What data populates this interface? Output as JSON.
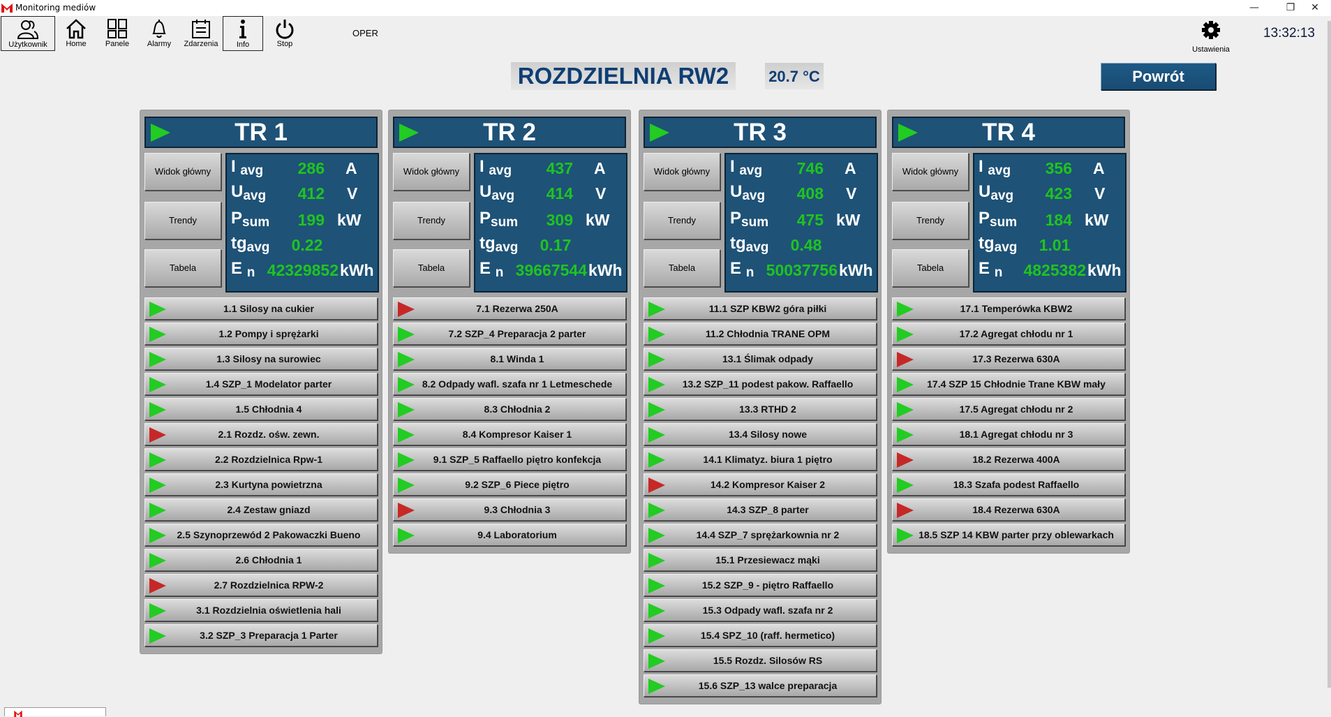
{
  "window": {
    "title": "Monitoring mediów",
    "controls": [
      "minimize",
      "restore",
      "close"
    ]
  },
  "toolbar": {
    "buttons": [
      {
        "label": "Użytkownik",
        "icon": "users-icon"
      },
      {
        "label": "Home",
        "icon": "home-icon"
      },
      {
        "label": "Panele",
        "icon": "panels-icon"
      },
      {
        "label": "Alarmy",
        "icon": "bell-icon"
      },
      {
        "label": "Zdarzenia",
        "icon": "calendar-icon"
      },
      {
        "label": "Info",
        "icon": "info-icon"
      },
      {
        "label": "Stop",
        "icon": "power-icon"
      }
    ],
    "mode": "OPER",
    "settings_label": "Ustawienia",
    "clock": "13:32:13"
  },
  "header": {
    "title": "ROZDZIELNIA RW2",
    "temperature": "20.7 °C",
    "back_label": "Powrót"
  },
  "colors": {
    "panel_blue": "#1e5277",
    "value_green": "#1fc41f",
    "status_ok": "#22cc22",
    "status_alarm": "#c62828",
    "title_blue": "#0e3e73"
  },
  "side_buttons": [
    "Widok główny",
    "Trendy",
    "Tabela"
  ],
  "measure_labels": {
    "i": {
      "main": "I",
      "sub": "avg",
      "unit": "A"
    },
    "u": {
      "main": "U",
      "sub": "avg",
      "unit": "V"
    },
    "p": {
      "main": "P",
      "sub": "sum",
      "unit": "kW"
    },
    "tg": {
      "main": "tg",
      "sub": "avg",
      "unit": ""
    },
    "e": {
      "main": "E",
      "sub": "n",
      "unit": "kWh"
    }
  },
  "transformers": [
    {
      "name": "TR 1",
      "status": "ok",
      "i_avg": "286",
      "u_avg": "412",
      "p_sum": "199",
      "tg_avg": "0.22",
      "e_n": "42329852",
      "circuits": [
        {
          "label": "1.1  Silosy na cukier",
          "status": "ok"
        },
        {
          "label": "1.2  Pompy i sprężarki",
          "status": "ok"
        },
        {
          "label": "1.3  Silosy na surowiec",
          "status": "ok"
        },
        {
          "label": "1.4  SZP_1 Modelator parter",
          "status": "ok"
        },
        {
          "label": "1.5  Chłodnia 4",
          "status": "ok"
        },
        {
          "label": "2.1  Rozdz. ośw. zewn.",
          "status": "alarm"
        },
        {
          "label": "2.2  Rozdzielnica Rpw-1",
          "status": "ok"
        },
        {
          "label": "2.3  Kurtyna powietrzna",
          "status": "ok"
        },
        {
          "label": "2.4  Zestaw gniazd",
          "status": "ok"
        },
        {
          "label": "2.5  Szynoprzewód 2 Pakowaczki Bueno",
          "status": "ok"
        },
        {
          "label": "2.6  Chłodnia 1",
          "status": "ok"
        },
        {
          "label": "2.7  Rozdzielnica RPW-2",
          "status": "alarm"
        },
        {
          "label": "3.1  Rozdzielnia oświetlenia hali",
          "status": "ok"
        },
        {
          "label": "3.2  SZP_3 Preparacja 1 Parter",
          "status": "ok"
        }
      ]
    },
    {
      "name": "TR 2",
      "status": "ok",
      "i_avg": "437",
      "u_avg": "414",
      "p_sum": "309",
      "tg_avg": "0.17",
      "e_n": "39667544",
      "circuits": [
        {
          "label": "7.1  Rezerwa 250A",
          "status": "alarm"
        },
        {
          "label": "7.2 SZP_4 Preparacja 2 parter",
          "status": "ok"
        },
        {
          "label": "8.1  Winda 1",
          "status": "ok"
        },
        {
          "label": "8.2  Odpady wafl. szafa nr 1 Letmeschede",
          "status": "ok"
        },
        {
          "label": "8.3  Chłodnia 2",
          "status": "ok"
        },
        {
          "label": "8.4  Kompresor Kaiser 1",
          "status": "ok"
        },
        {
          "label": "9.1  SZP_5 Raffaello piętro konfekcja",
          "status": "ok"
        },
        {
          "label": "9.2  SZP_6 Piece piętro",
          "status": "ok"
        },
        {
          "label": "9.3 Chłodnia 3",
          "status": "alarm"
        },
        {
          "label": "9.4  Laboratorium",
          "status": "ok"
        }
      ]
    },
    {
      "name": "TR 3",
      "status": "ok",
      "i_avg": "746",
      "u_avg": "408",
      "p_sum": "475",
      "tg_avg": "0.48",
      "e_n": "50037756",
      "circuits": [
        {
          "label": "11.1  SZP KBW2 góra piłki",
          "status": "ok"
        },
        {
          "label": "11.2  Chłodnia TRANE OPM",
          "status": "ok"
        },
        {
          "label": "13.1 Ślimak odpady",
          "status": "ok"
        },
        {
          "label": "13.2  SZP_11 podest pakow. Raffaello",
          "status": "ok"
        },
        {
          "label": "13.3 RTHD 2",
          "status": "ok"
        },
        {
          "label": "13.4 Silosy nowe",
          "status": "ok"
        },
        {
          "label": "14.1  Klimatyz. biura 1 piętro",
          "status": "ok"
        },
        {
          "label": "14.2  Kompresor Kaiser 2",
          "status": "alarm"
        },
        {
          "label": "14.3  SZP_8 parter",
          "status": "ok"
        },
        {
          "label": "14.4  SZP_7 sprężarkownia nr 2",
          "status": "ok"
        },
        {
          "label": "15.1  Przesiewacz mąki",
          "status": "ok"
        },
        {
          "label": "15.2 SZP_9 - piętro Raffaello",
          "status": "ok"
        },
        {
          "label": "15.3  Odpady wafl. szafa nr 2",
          "status": "ok"
        },
        {
          "label": "15.4  SPZ_10 (raff. hermetico)",
          "status": "ok"
        },
        {
          "label": "15.5  Rozdz. Silosów RS",
          "status": "ok"
        },
        {
          "label": "15.6  SZP_13 walce preparacja",
          "status": "ok"
        }
      ]
    },
    {
      "name": "TR 4",
      "status": "ok",
      "i_avg": "356",
      "u_avg": "423",
      "p_sum": "184",
      "tg_avg": "1.01",
      "e_n": "4825382",
      "circuits": [
        {
          "label": "17.1  Temperówka KBW2",
          "status": "ok"
        },
        {
          "label": "17.2  Agregat chłodu nr 1",
          "status": "ok"
        },
        {
          "label": "17.3  Rezerwa 630A",
          "status": "alarm"
        },
        {
          "label": "17.4  SZP 15 Chłodnie Trane KBW mały",
          "status": "ok"
        },
        {
          "label": "17.5 Agregat chłodu nr 2",
          "status": "ok"
        },
        {
          "label": "18.1  Agregat chłodu nr 3",
          "status": "ok"
        },
        {
          "label": "18.2 Rezerwa 400A",
          "status": "alarm"
        },
        {
          "label": "18.3  Szafa podest Raffaello",
          "status": "ok"
        },
        {
          "label": "18.4 Rezerwa 630A",
          "status": "alarm"
        },
        {
          "label": "18.5  SZP 14 KBW parter przy oblewarkach",
          "status": "ok"
        }
      ]
    }
  ]
}
